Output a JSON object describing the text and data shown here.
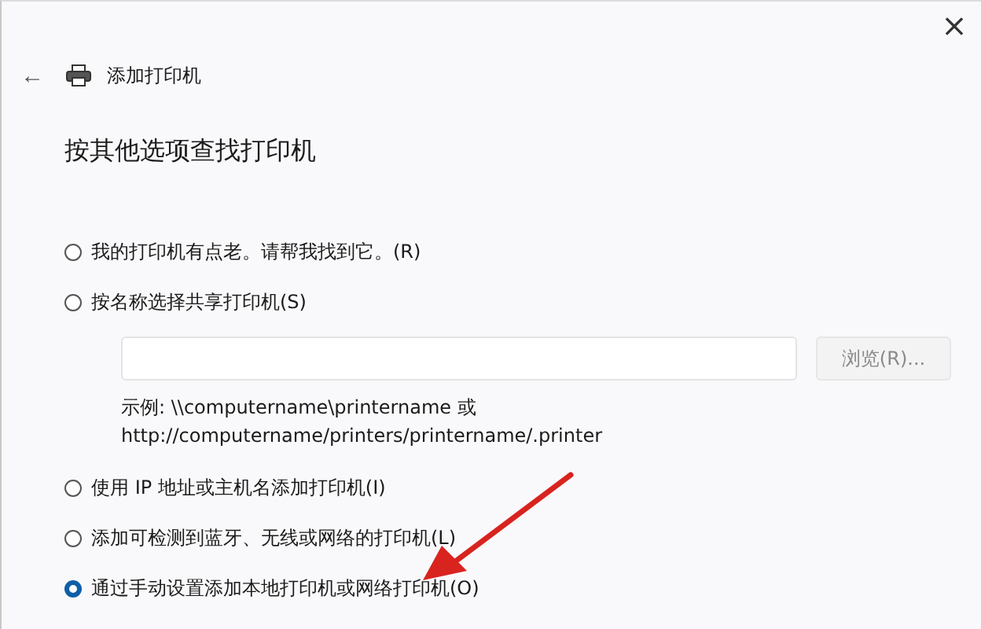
{
  "window": {
    "close": "×"
  },
  "header": {
    "back": "←",
    "title": "添加打印机"
  },
  "heading": "按其他选项查找打印机",
  "options": [
    {
      "label": "我的打印机有点老。请帮我找到它。(R)",
      "selected": false
    },
    {
      "label": "按名称选择共享打印机(S)",
      "selected": false,
      "has_field": true,
      "browse": {
        "label": "浏览(R)...",
        "disabled": true
      },
      "example": [
        "示例: \\\\computername\\printername 或",
        "http://computername/printers/printername/.printer"
      ]
    },
    {
      "label": "使用 IP 地址或主机名添加打印机(I)",
      "selected": false
    },
    {
      "label": "添加可检测到蓝牙、无线或网络的打印机(L)",
      "selected": false
    },
    {
      "label": "通过手动设置添加本地打印机或网络打印机(O)",
      "selected": true
    }
  ]
}
